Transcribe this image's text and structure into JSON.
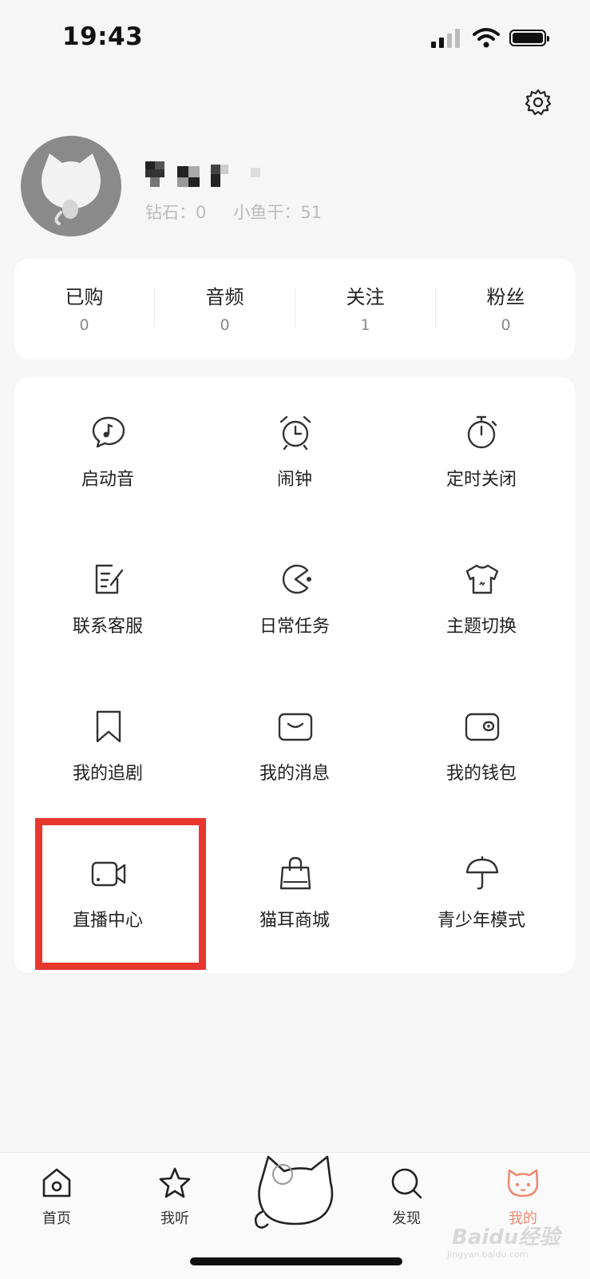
{
  "status_bar": {
    "time": "19:43"
  },
  "profile": {
    "diamonds_label": "钻石：",
    "diamonds_value": "0",
    "fish_label": "小鱼干：",
    "fish_value": "51"
  },
  "counts": [
    {
      "label": "已购",
      "value": "0"
    },
    {
      "label": "音频",
      "value": "0"
    },
    {
      "label": "关注",
      "value": "1"
    },
    {
      "label": "粉丝",
      "value": "0"
    }
  ],
  "grid": [
    {
      "label": "启动音",
      "icon": "speech-bubble-music-icon"
    },
    {
      "label": "闹钟",
      "icon": "alarm-clock-icon"
    },
    {
      "label": "定时关闭",
      "icon": "stopwatch-icon"
    },
    {
      "label": "联系客服",
      "icon": "edit-note-icon"
    },
    {
      "label": "日常任务",
      "icon": "pacman-icon"
    },
    {
      "label": "主题切换",
      "icon": "tshirt-icon"
    },
    {
      "label": "我的追剧",
      "icon": "bookmark-icon"
    },
    {
      "label": "我的消息",
      "icon": "message-icon"
    },
    {
      "label": "我的钱包",
      "icon": "wallet-icon"
    },
    {
      "label": "直播中心",
      "icon": "video-camera-icon"
    },
    {
      "label": "猫耳商城",
      "icon": "shopping-bag-icon"
    },
    {
      "label": "青少年模式",
      "icon": "umbrella-icon"
    }
  ],
  "tabs": [
    {
      "label": "首页",
      "icon": "home-icon"
    },
    {
      "label": "我听",
      "icon": "star-icon"
    },
    {
      "label": "发现",
      "icon": "search-icon"
    },
    {
      "label": "我的",
      "icon": "cat-face-icon"
    }
  ],
  "watermark": {
    "brand": "Baidu经验",
    "url": "jingyan.baidu.com"
  },
  "colors": {
    "highlight": "#e8372e",
    "active_tab": "#f08a74"
  }
}
